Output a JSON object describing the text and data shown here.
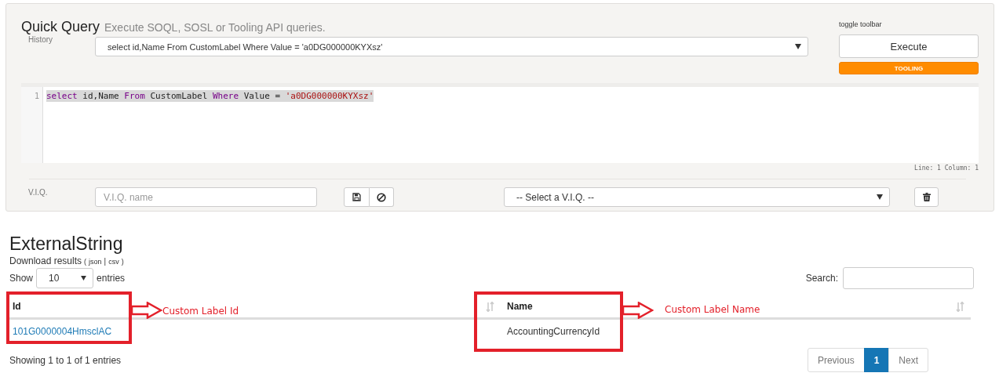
{
  "query_panel": {
    "title": "Quick Query",
    "subtitle": "Execute SOQL, SOSL or Tooling API queries.",
    "history_label": "History",
    "history_select": "select id,Name From CustomLabel Where Value = 'a0DG000000KYXsz'",
    "toggle_toolbar": "toggle toolbar",
    "execute_button": "Execute",
    "tooling_badge": "TOOLING",
    "editor": {
      "line_number": "1",
      "highlighted": true,
      "tokens": [
        {
          "text": "select",
          "kind": "keyword"
        },
        {
          "text": " id,Name ",
          "kind": "plain"
        },
        {
          "text": "From",
          "kind": "keyword"
        },
        {
          "text": " CustomLabel ",
          "kind": "plain"
        },
        {
          "text": "Where",
          "kind": "keyword"
        },
        {
          "text": " Value = ",
          "kind": "plain"
        },
        {
          "text": "'a0DG000000KYXsz'",
          "kind": "string"
        }
      ]
    },
    "cursor_status": "Line: 1 Column: 1",
    "viq_label": "V.I.Q.",
    "viq_name_placeholder": "V.I.Q. name",
    "viq_select": "-- Select a V.I.Q. --"
  },
  "results": {
    "title": "ExternalString",
    "download_label": "Download results",
    "download_open": "(",
    "download_links": [
      "json",
      "csv"
    ],
    "download_separator": "|",
    "download_close": ")",
    "show_label": "Show",
    "page_size": "10",
    "entries_label": "entries",
    "search_label": "Search:",
    "columns": [
      "Id",
      "Name"
    ],
    "rows": [
      [
        "101G0000004HmsclAC",
        "AccountingCurrencyId"
      ]
    ],
    "info": "Showing 1 to 1 of 1 entries",
    "pagination": [
      {
        "label": "Previous",
        "selected": false
      },
      {
        "label": "1",
        "selected": true
      },
      {
        "label": "Next",
        "selected": false
      }
    ]
  },
  "annotations": [
    {
      "text": "Custom Label Id"
    },
    {
      "text": "Custom Label Name"
    }
  ]
}
